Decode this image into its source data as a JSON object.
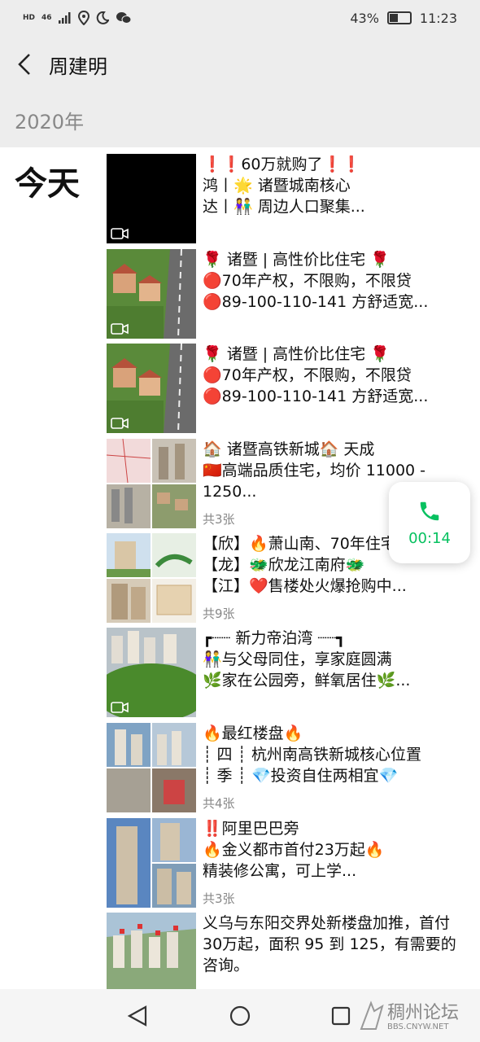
{
  "status_bar": {
    "network": "46",
    "battery": "43%",
    "battery_level": 0.43,
    "time": "11:23"
  },
  "header": {
    "title": "周建明"
  },
  "year": "2020年",
  "today": "今天",
  "posts": [
    {
      "lines": [
        "❗❗60万就购了❗❗",
        "鸿丨🌟 诸暨城南核心",
        "达丨👫 周边人口聚集..."
      ],
      "count": ""
    },
    {
      "lines": [
        "🌹 诸暨 | 高性价比住宅 🌹",
        "🔴70年产权，不限购，不限贷",
        "🔴89-100-110-141 方舒适宽..."
      ],
      "count": ""
    },
    {
      "lines": [
        "🌹 诸暨 | 高性价比住宅 🌹",
        "🔴70年产权，不限购，不限贷",
        "🔴89-100-110-141 方舒适宽..."
      ],
      "count": ""
    },
    {
      "lines": [
        "🏠 诸暨高铁新城🏠 天成",
        "🇨🇳高端品质住宅，均价 11000 -",
        "1250..."
      ],
      "count": "共3张"
    },
    {
      "lines": [
        "【欣】🔥萧山南、70年住宅",
        "【龙】🐲欣龙江南府🐲",
        "【江】❤️售楼处火爆抢购中..."
      ],
      "count": "共9张"
    },
    {
      "lines": [
        "┏┈┈ 新力帝泊湾 ┈┈┓",
        "👫与父母同住，享家庭圆满",
        "🌿家在公园旁，鲜氧居住🌿..."
      ],
      "count": ""
    },
    {
      "lines": [
        "🔥最红楼盘🔥",
        "┊ 四 ┊ 杭州南高铁新城核心位置",
        "┊ 季 ┊ 💎投资自住两相宜💎"
      ],
      "count": "共4张"
    },
    {
      "lines": [
        "‼️阿里巴巴旁",
        "🔥金义都市首付23万起🔥",
        "精装修公寓，可上学..."
      ],
      "count": "共3张"
    },
    {
      "lines": [
        "义乌与东阳交界处新楼盘加推，首付",
        "30万起，面积 95 到 125，有需要的",
        "咨询。"
      ],
      "count": ""
    }
  ],
  "call": {
    "duration": "00:14"
  },
  "watermark": {
    "title": "稠州论坛",
    "url": "BBS.CNYW.NET"
  }
}
